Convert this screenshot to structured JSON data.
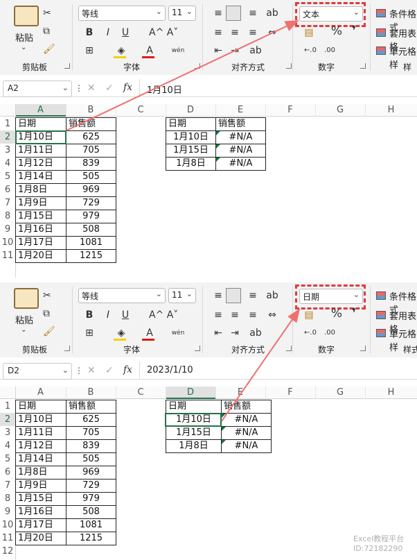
{
  "colors": {
    "accent": "#217346",
    "arrow": "#f07070",
    "dash": "#e03b3b"
  },
  "panels": [
    {
      "ribbon": {
        "paste_label": "粘贴",
        "clipboard_title": "剪贴板",
        "font_name": "等线",
        "font_size": "11",
        "font_title": "字体",
        "align_title": "对齐方式",
        "number_format": "文本",
        "number_title": "数字",
        "percent": "%",
        "comma": "❜",
        "cond_format": "条件格式",
        "table_format": "套用表格",
        "cell_style": "单元格样",
        "style_title": "样"
      },
      "namebox": "A2",
      "formula": "1月10日",
      "columns": [
        "A",
        "B",
        "C",
        "D",
        "E",
        "F",
        "G",
        "H"
      ],
      "rows": [
        "1",
        "2",
        "3",
        "4",
        "5",
        "6",
        "7",
        "8",
        "9",
        "10",
        "11"
      ],
      "left_table": {
        "header": [
          "日期",
          "销售额"
        ],
        "rows": [
          [
            "1月10日",
            "625"
          ],
          [
            "1月11日",
            "705"
          ],
          [
            "1月12日",
            "839"
          ],
          [
            "1月14日",
            "505"
          ],
          [
            "1月8日",
            "969"
          ],
          [
            "1月9日",
            "729"
          ],
          [
            "1月15日",
            "979"
          ],
          [
            "1月16日",
            "508"
          ],
          [
            "1月17日",
            "1081"
          ],
          [
            "1月20日",
            "1215"
          ]
        ]
      },
      "right_table": {
        "header": [
          "日期",
          "销售额"
        ],
        "rows": [
          [
            "1月10日",
            "#N/A"
          ],
          [
            "1月15日",
            "#N/A"
          ],
          [
            "1月8日",
            "#N/A"
          ]
        ]
      }
    },
    {
      "ribbon": {
        "paste_label": "粘贴",
        "clipboard_title": "剪贴板",
        "font_name": "等线",
        "font_size": "11",
        "font_title": "字体",
        "align_title": "对齐方式",
        "number_format": "日期",
        "number_title": "数字",
        "percent": "%",
        "comma": "❜",
        "cond_format": "条件格式",
        "table_format": "套用表格",
        "cell_style": "单元格样",
        "style_title": "样式"
      },
      "namebox": "D2",
      "formula": "2023/1/10",
      "columns": [
        "A",
        "B",
        "C",
        "D",
        "E",
        "F",
        "G",
        "H"
      ],
      "rows": [
        "1",
        "2",
        "3",
        "4",
        "5",
        "6",
        "7",
        "8",
        "9",
        "10",
        "11",
        "12"
      ],
      "left_table": {
        "header": [
          "日期",
          "销售额"
        ],
        "rows": [
          [
            "1月10日",
            "625"
          ],
          [
            "1月11日",
            "705"
          ],
          [
            "1月12日",
            "839"
          ],
          [
            "1月14日",
            "505"
          ],
          [
            "1月8日",
            "969"
          ],
          [
            "1月9日",
            "729"
          ],
          [
            "1月15日",
            "979"
          ],
          [
            "1月16日",
            "508"
          ],
          [
            "1月17日",
            "1081"
          ],
          [
            "1月20日",
            "1215"
          ]
        ]
      },
      "right_table": {
        "header": [
          "日期",
          "销售额"
        ],
        "rows": [
          [
            "1月10日",
            "#N/A"
          ],
          [
            "1月15日",
            "#N/A"
          ],
          [
            "1月8日",
            "#N/A"
          ]
        ]
      }
    }
  ],
  "watermark": {
    "line1": "Excel教程平台",
    "line2": "ID:72182290"
  }
}
